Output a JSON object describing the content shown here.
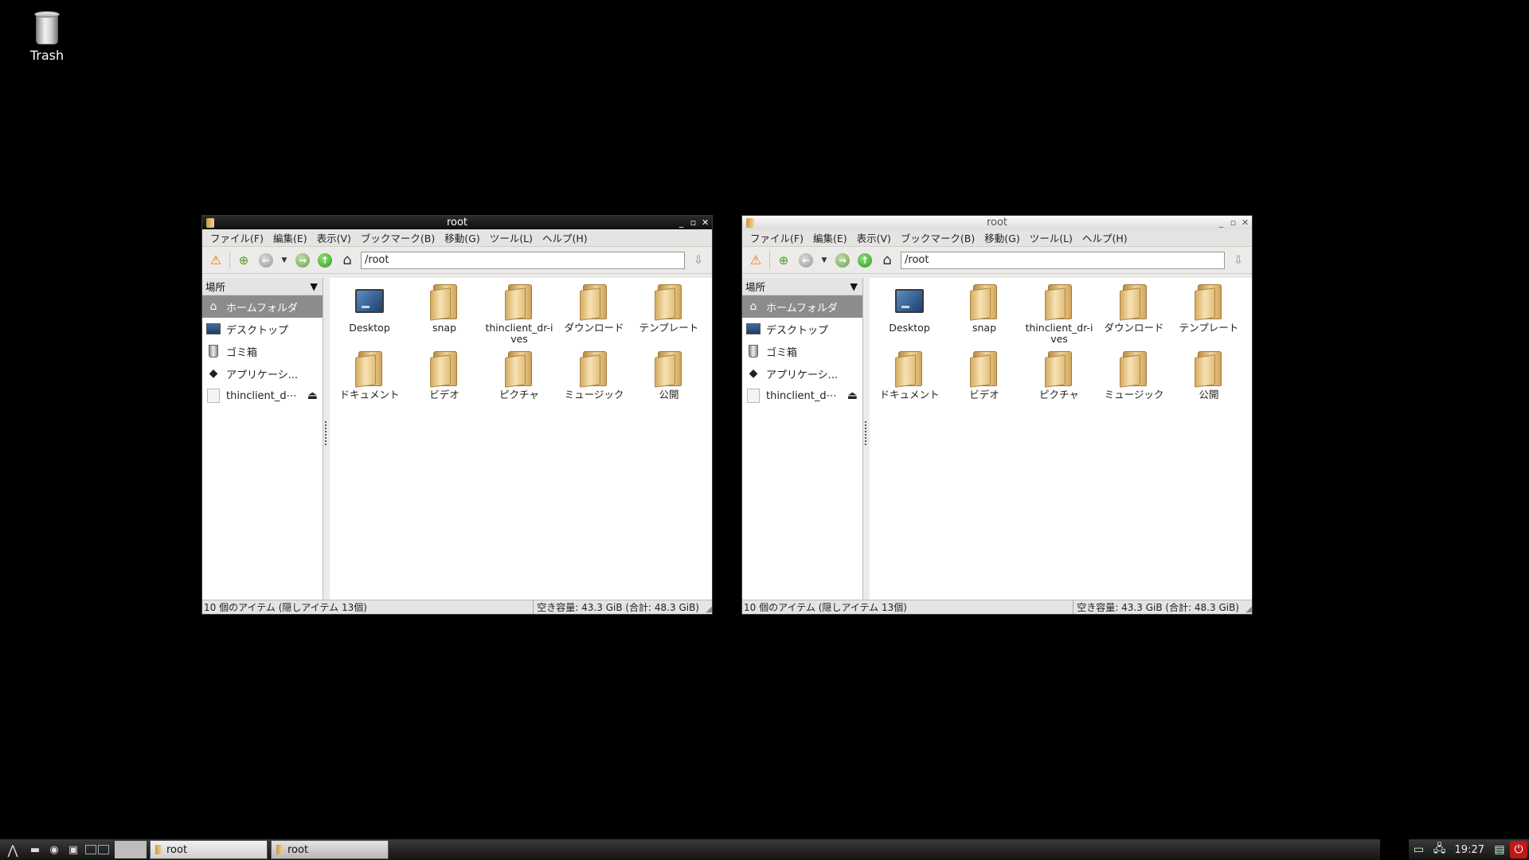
{
  "desktop": {
    "trash_label": "Trash"
  },
  "window1": {
    "title": "root",
    "focused": true,
    "menu": [
      "ファイル(F)",
      "編集(E)",
      "表示(V)",
      "ブックマーク(B)",
      "移動(G)",
      "ツール(L)",
      "ヘルプ(H)"
    ],
    "path": "/root",
    "sidebar_header": "場所",
    "sidebar_items": [
      "ホームフォルダ",
      "デスクトップ",
      "ゴミ箱",
      "アプリケーシ...",
      "thinclient_d⋯"
    ],
    "files": [
      "Desktop",
      "snap",
      "thinclient_dr-ives",
      "ダウンロード",
      "テンプレート",
      "ドキュメント",
      "ビデオ",
      "ピクチャ",
      "ミュージック",
      "公開"
    ],
    "status_left": "10 個のアイテム (隠しアイテム 13個)",
    "status_right": "空き容量: 43.3 GiB (合計: 48.3 GiB)"
  },
  "window2": {
    "title": "root",
    "focused": false,
    "menu": [
      "ファイル(F)",
      "編集(E)",
      "表示(V)",
      "ブックマーク(B)",
      "移動(G)",
      "ツール(L)",
      "ヘルプ(H)"
    ],
    "path": "/root",
    "sidebar_header": "場所",
    "sidebar_items": [
      "ホームフォルダ",
      "デスクトップ",
      "ゴミ箱",
      "アプリケーシ...",
      "thinclient_d⋯"
    ],
    "files": [
      "Desktop",
      "snap",
      "thinclient_dr-ives",
      "ダウンロード",
      "テンプレート",
      "ドキュメント",
      "ビデオ",
      "ピクチャ",
      "ミュージック",
      "公開"
    ],
    "status_left": "10 個のアイテム (隠しアイテム 13個)",
    "status_right": "空き容量: 43.3 GiB (合計: 48.3 GiB)"
  },
  "taskbar": {
    "tasks": [
      "root",
      "root"
    ],
    "clock": "19:27"
  }
}
